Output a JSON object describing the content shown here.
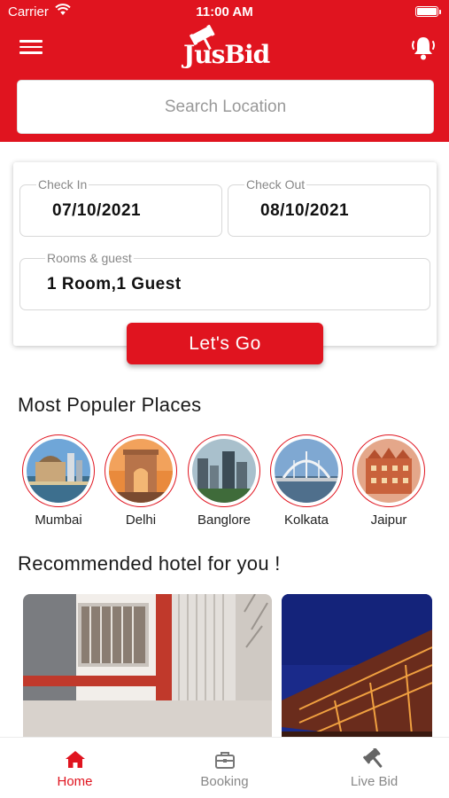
{
  "status_bar": {
    "carrier": "Carrier",
    "time": "11:00 AM"
  },
  "header": {
    "logo_text": "JusBid",
    "brand_color": "#e0141f",
    "menu_icon": "hamburger-menu-icon",
    "notification_icon": "bell-icon"
  },
  "search": {
    "placeholder": "Search Location",
    "value": ""
  },
  "booking": {
    "check_in": {
      "label": "Check In",
      "value": "07/10/2021"
    },
    "check_out": {
      "label": "Check Out",
      "value": "08/10/2021"
    },
    "rooms": {
      "label": "Rooms & guest",
      "value": "1 Room,1 Guest"
    },
    "submit_label": "Let's Go"
  },
  "popular": {
    "title": "Most Populer Places",
    "places": [
      {
        "name": "Mumbai"
      },
      {
        "name": "Delhi"
      },
      {
        "name": "Banglore"
      },
      {
        "name": "Kolkata"
      },
      {
        "name": "Jaipur"
      }
    ]
  },
  "recommended": {
    "title": "Recommended hotel for you !"
  },
  "tabs": [
    {
      "label": "Home",
      "icon": "home-icon",
      "active": true
    },
    {
      "label": "Booking",
      "icon": "briefcase-icon",
      "active": false
    },
    {
      "label": "Live Bid",
      "icon": "gavel-icon",
      "active": false
    }
  ]
}
